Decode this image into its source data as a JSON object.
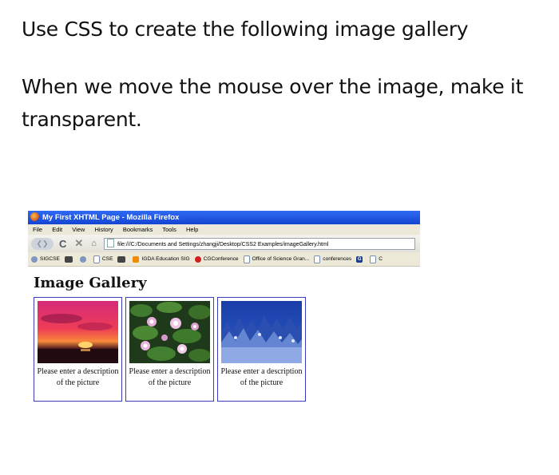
{
  "question": {
    "line1": "Use CSS to create the following image gallery",
    "line2": "When we move the mouse over the image, make it transparent."
  },
  "browser": {
    "title": "My First XHTML Page - Mozilla Firefox",
    "menu": [
      "File",
      "Edit",
      "View",
      "History",
      "Bookmarks",
      "Tools",
      "Help"
    ],
    "nav": {
      "back_icon": "back-arrow-icon",
      "reload_icon": "reload-icon",
      "stop_icon": "stop-icon",
      "home_icon": "home-icon",
      "url": "file:///C:/Documents and Settings/zhangji/Desktop/CSS2 Examples/imageGallery.html"
    },
    "bookmarks": [
      {
        "label": "SIGCSE",
        "icon": "globe-icon"
      },
      {
        "label": "",
        "icon": "bookmark-icon"
      },
      {
        "label": "",
        "icon": "bookmark-icon"
      },
      {
        "label": "CSE",
        "icon": "page-icon"
      },
      {
        "label": "",
        "icon": "bookmark-icon"
      },
      {
        "label": "IGDA Education SIG",
        "icon": "igda-icon"
      },
      {
        "label": "CGConference",
        "icon": "cg-icon"
      },
      {
        "label": "Office of Science Gran...",
        "icon": "page-icon"
      },
      {
        "label": "conferences",
        "icon": "page-icon"
      },
      {
        "label": "",
        "icon": "google-icon"
      },
      {
        "label": "C",
        "icon": "page-icon"
      }
    ]
  },
  "gallery": {
    "heading": "Image Gallery",
    "items": [
      {
        "description": "Please enter a description of the picture",
        "image": "sunset-image"
      },
      {
        "description": "Please enter a description of the picture",
        "image": "water-lilies-image"
      },
      {
        "description": "Please enter a description of the picture",
        "image": "winter-trees-image"
      }
    ]
  },
  "colors": {
    "titlebar": "#1f56e0",
    "card_border": "#3b3bbf"
  }
}
